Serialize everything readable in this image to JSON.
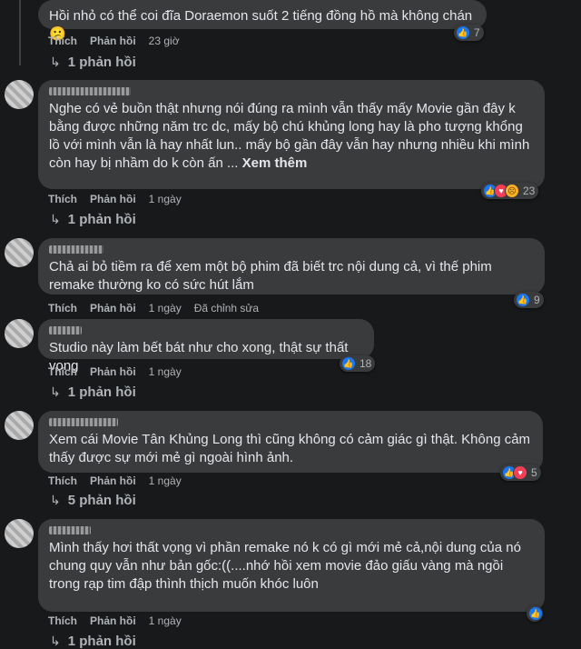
{
  "labels": {
    "like": "Thích",
    "reply": "Phản hồi",
    "see_more": "Xem thêm",
    "edited": "Đã chỉnh sửa"
  },
  "comments": [
    {
      "text": "Hồi nhỏ có thể coi đĩa Doraemon suốt 2 tiếng đồng hồ mà không chán 😕",
      "time": "23 giờ",
      "reactions": [
        "like"
      ],
      "reaction_count": "7",
      "replies": "1 phản hồi"
    },
    {
      "text": "Nghe có vẻ buồn thật nhưng nói đúng ra mình vẫn thấy mấy Movie gần đây k bằng được những năm trc dc, mấy bộ chú khủng long hay là pho tượng khổng lồ với mình vẫn là hay nhất lun.. mấy bộ gần đây vẫn hay nhưng nhiều khi mình còn hay bị nhầm do k còn ấn ...",
      "time": "1 ngày",
      "reactions": [
        "like",
        "love",
        "sad"
      ],
      "reaction_count": "23",
      "replies": "1 phản hồi"
    },
    {
      "text": "Chả ai bỏ tiềm ra để xem một bộ phim đã biết trc nội dung cả, vì thế phim remake thường ko có sức hút lắm",
      "time": "1 ngày",
      "reactions": [
        "like"
      ],
      "reaction_count": "9",
      "edited": true
    },
    {
      "text": "Studio này làm bết bát như cho xong, thật sự thất vọng",
      "time": "1 ngày",
      "reactions": [
        "like"
      ],
      "reaction_count": "18",
      "replies": "1 phản hồi"
    },
    {
      "text": "Xem cái Movie Tân Khủng Long thì cũng không có cảm giác gì thật. Không cảm thấy được sự mới mẻ gì ngoài hình ảnh.",
      "time": "1 ngày",
      "reactions": [
        "like",
        "love"
      ],
      "reaction_count": "5",
      "replies": "5 phản hồi"
    },
    {
      "text": "Mình thấy hơi thất vọng vì phần remake nó k có gì mới mẻ cả,nội dung của nó chung quy vẫn như bản gốc:((....nhớ hồi xem movie đảo giấu vàng mà ngồi trong rạp tim đập thình thịch muốn khóc luôn",
      "time": "1 ngày",
      "reactions": [
        "like"
      ]
    },
    {
      "replies": "1 phản hồi"
    }
  ],
  "colors": {
    "background": "#18191a",
    "bubble": "#3a3b3c",
    "like": "#1877f2",
    "love": "#f33e58",
    "sad": "#f7b125"
  }
}
